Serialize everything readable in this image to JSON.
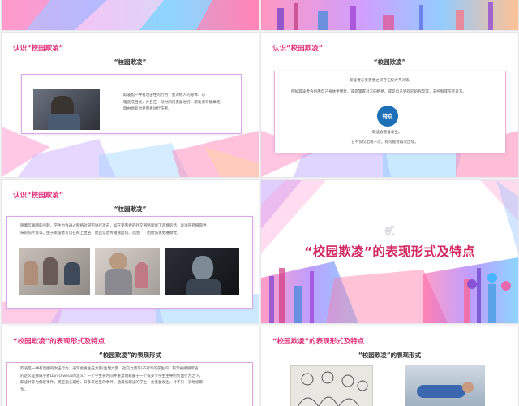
{
  "slides": {
    "s3": {
      "section_title": "认识“校园欺凌”",
      "subtitle": "“校园欺凌”",
      "para_lines": [
        "欺凌指一种有攻击性的行为，会对他人的身体、心",
        "理造成困扰，并且在一段时间内重复进行。欺凌者可能乘无",
        "理由地就对受害者进行伤害。"
      ]
    },
    "s4": {
      "section_title": "认识“校园欺凌”",
      "subtitle": "“校园欺凌”",
      "line1": "欺凌者与受害者之间存在权力不对等。",
      "line2": "例如欺凌者会利用自己身体更健壮、或是掌握对方的把柄、或是自己受欢迎的程度等，去控制或伤害对方。",
      "badge": "特点",
      "line3": "欺凌会重复发生。",
      "line4": "它不仅仅出现一次，有可能会再次出现。"
    },
    "s5": {
      "section_title": "认识“校园欺凌”",
      "subtitle": "“校园欺凌”",
      "para_lines": [
        "随着互联网的兴起，学生也会通过网络对同学进行攻击，如在受害者的社交网络里留下恶意的话，发送带有侮辱性",
        "味的照片等等。由于欺凌者可以在网上匿名，而且信息传播速度快、范围广，因而伤害更难察觉。"
      ]
    },
    "s6": {
      "num_char": "贰",
      "title": "“校园欺凌”的表现形式及特点"
    },
    "s7": {
      "section_title": "“校园欺凌”的表现形式及特点",
      "subtitle": "“校园欺凌”的表现形式",
      "para_lines": [
        "欺凌是一种有意图的攻击行为，通常会发生在力量(生理力量、社交力量等)不对等的学生间。较常被接受欺凌",
        "的定义是挪威学者Dan Olweus的定义：一个学生长时间并重复地暴露于一个或多个学生主导的负面行为之下。",
        "欺凌并非为偶发事件，而是指长期性、日多次发生的事件。通常被欺凌的学生，会重复发生，并不只一次地被欺",
        "负。"
      ]
    },
    "s8": {
      "section_title": "“校园欺凌”的表现形式及特点",
      "subtitle": "“校园欺凌”的表现形式"
    }
  },
  "colors": {
    "accent_pink": "#e0307a",
    "title_red": "#d2275f",
    "badge_blue": "#1d6fb8"
  }
}
